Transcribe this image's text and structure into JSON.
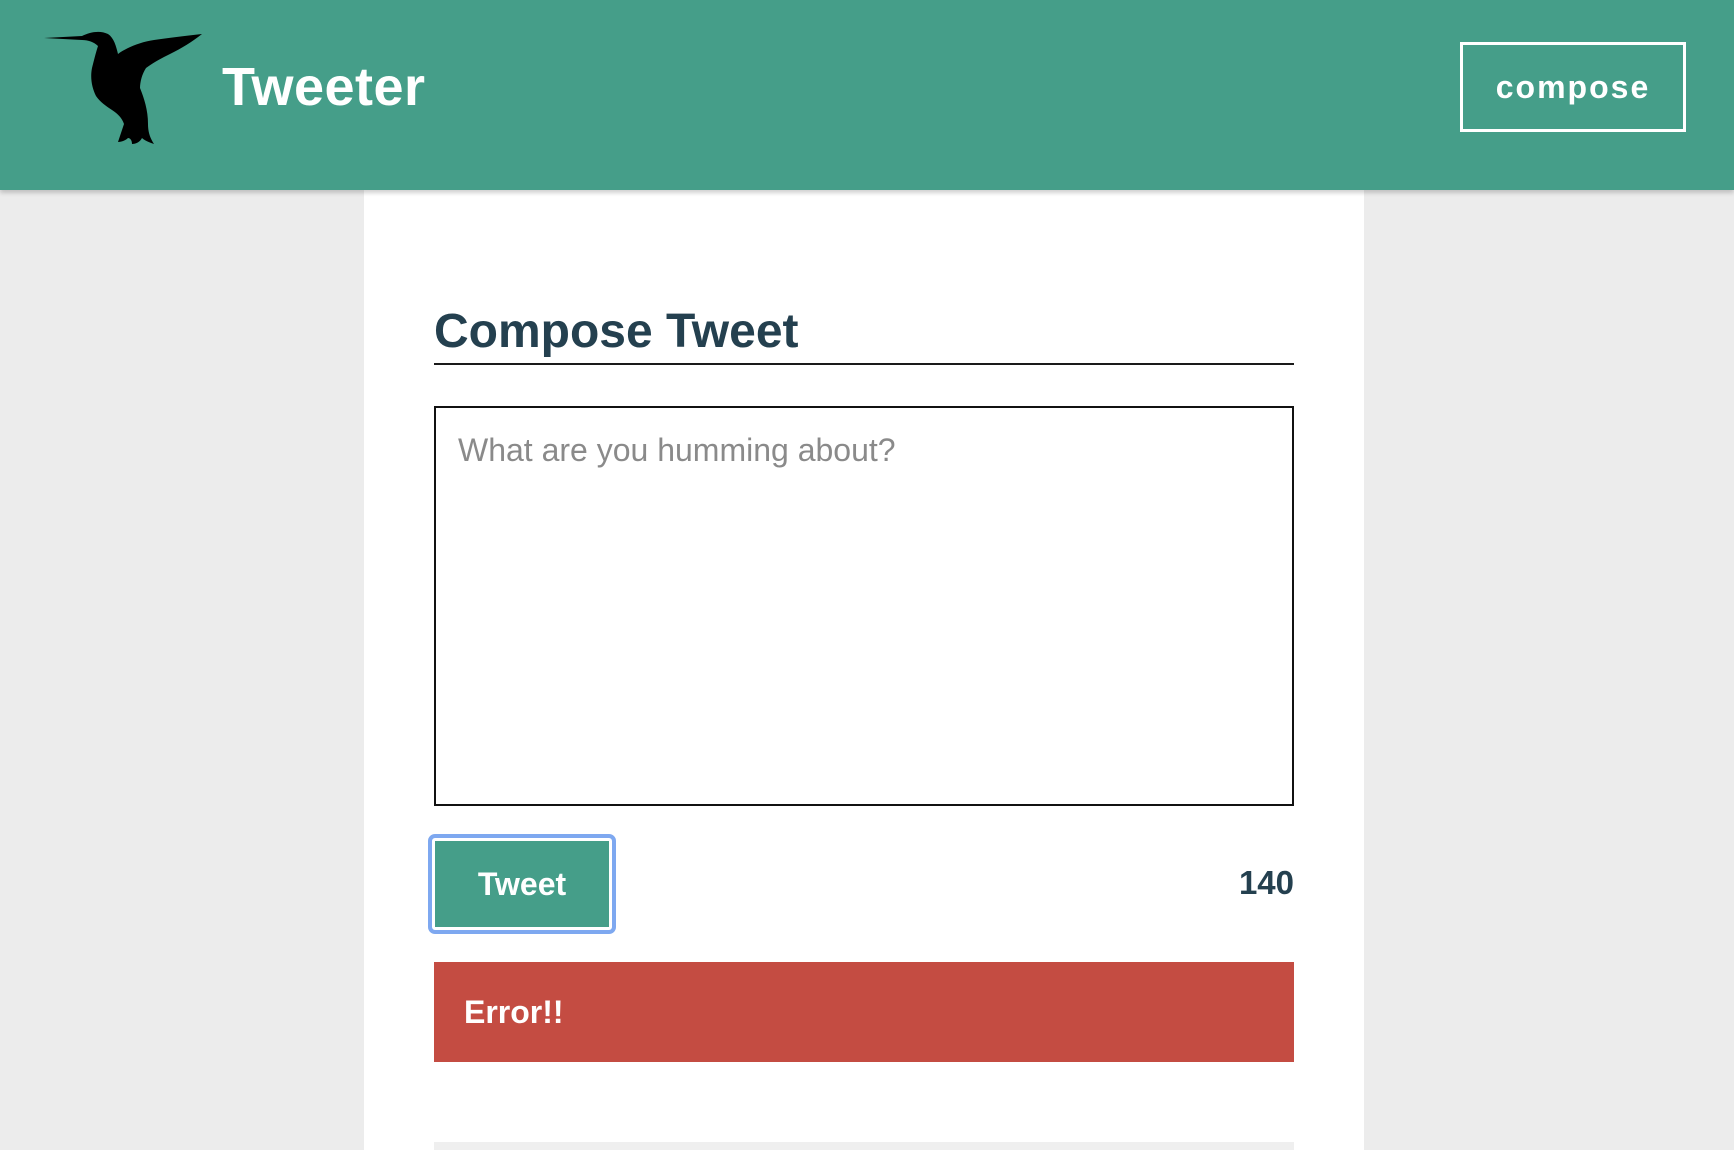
{
  "header": {
    "logo_icon": "hummingbird-icon",
    "brand": "Tweeter",
    "compose_label": "compose",
    "background_color": "#459e89"
  },
  "composer": {
    "title": "Compose Tweet",
    "input_placeholder": "What are you humming about?",
    "input_value": "",
    "submit_label": "Tweet",
    "char_counter": "140"
  },
  "error": {
    "message": "Error!!",
    "color": "#c44c42"
  }
}
